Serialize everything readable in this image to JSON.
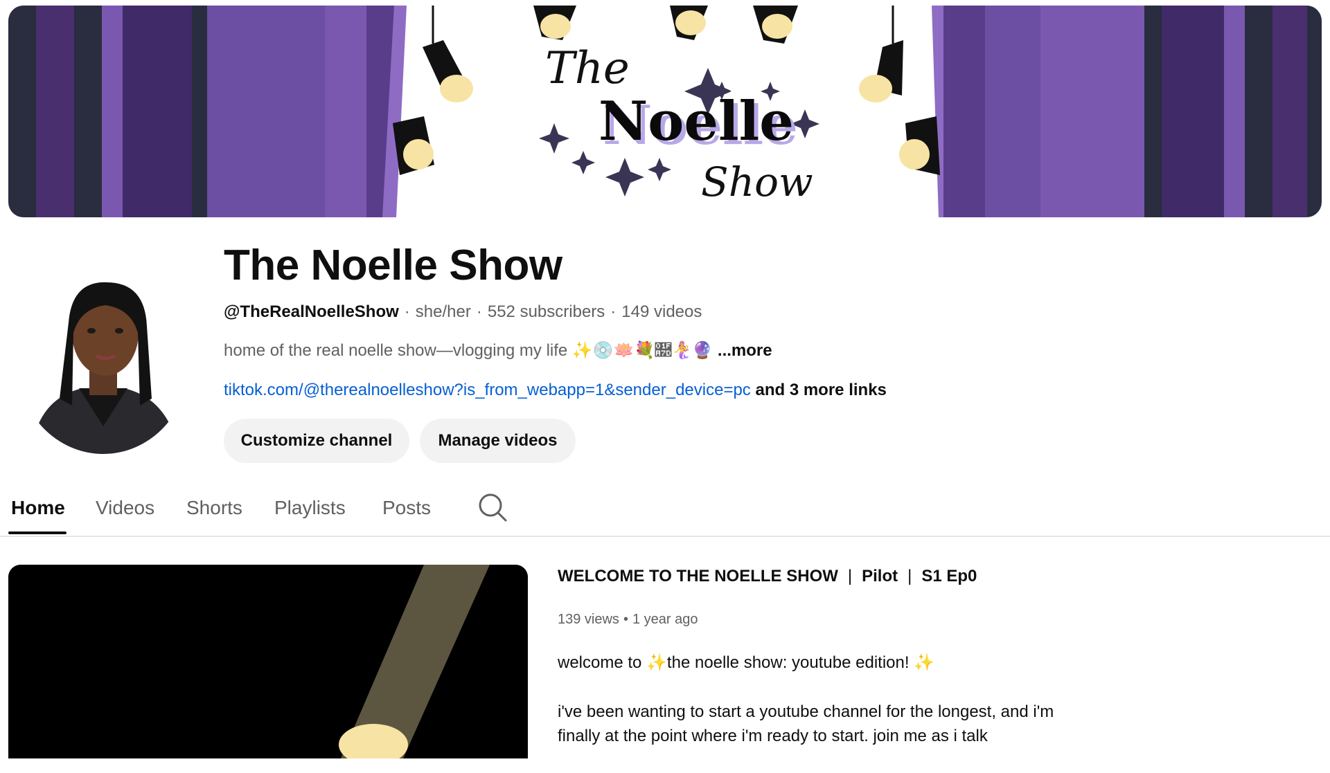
{
  "banner": {
    "logo_top": "The",
    "logo_main": "Noelle",
    "logo_bottom": "Show",
    "colors": {
      "curtain_light": "#7a58b0",
      "curtain_mid": "#54357f",
      "curtain_dark": "#2a2c3f",
      "spotlight": "#f7e3a3",
      "star": "#3a3554",
      "logo_shadow": "#b8a8e8"
    }
  },
  "channel": {
    "title": "The Noelle Show",
    "handle": "@TheRealNoelleShow",
    "pronouns": "she/her",
    "subscribers": "552 subscribers",
    "videos": "149 videos",
    "description": "home of the real noelle show—vlogging my life ✨💿🪷💐🩽🧜‍♀️🔮",
    "more_label": "...more",
    "link": "tiktok.com/@therealnoelleshow?is_from_webapp=1&sender_device=pc",
    "more_links": "and 3 more links",
    "customize_label": "Customize channel",
    "manage_label": "Manage videos"
  },
  "tabs": [
    "Home",
    "Videos",
    "Shorts",
    "Playlists",
    "Posts"
  ],
  "tab_active": "Home",
  "featured": {
    "title_part1": "WELCOME TO THE NOELLE SHOW",
    "title_part2": "Pilot",
    "title_part3": "S1 Ep0",
    "title_separator": "|",
    "views": "139 views",
    "age": "1 year ago",
    "desc_line1": "welcome to ✨the noelle show: youtube edition! ✨",
    "desc_line2": "i've been wanting to start a youtube channel for the longest, and i'm finally at the point where i'm ready to start. join me as i talk"
  },
  "icons": {
    "search": "search-icon"
  }
}
